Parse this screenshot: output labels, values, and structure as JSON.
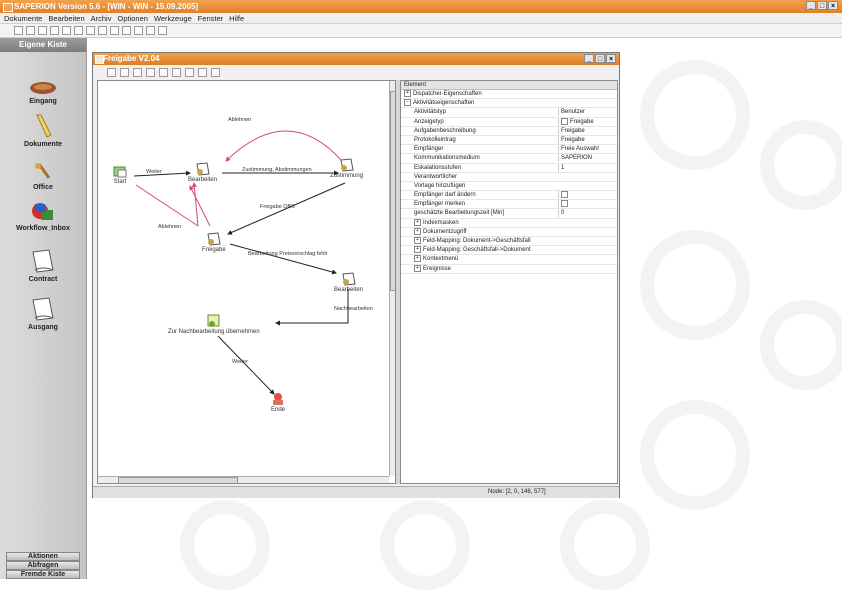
{
  "app": {
    "title": "SAPERION Version 5.6 - [WIN - WIN - 15.09.2005]"
  },
  "menu": [
    "Dokumente",
    "Bearbeiten",
    "Archiv",
    "Optionen",
    "Werkzeuge",
    "Fenster",
    "Hilfe"
  ],
  "sidebar": {
    "title": "Eigene Kiste",
    "items": [
      {
        "label": "Eingang",
        "icon": "inbox-icon"
      },
      {
        "label": "Dokumente",
        "icon": "pen-icon"
      },
      {
        "label": "Office",
        "icon": "office-icon"
      },
      {
        "label": "Workflow_Inbox",
        "icon": "workflow-icon"
      },
      {
        "label": "Contract",
        "icon": "document-icon"
      },
      {
        "label": "Ausgang",
        "icon": "document-icon"
      }
    ],
    "bottom_buttons": [
      "Aktionen",
      "Abfragen",
      "Fremde Kiste"
    ]
  },
  "document": {
    "title": "Freigabe V2.04",
    "status": "Node: [2, 0, 146, 577]"
  },
  "workflow": {
    "nodes": [
      {
        "label": "Start"
      },
      {
        "label": "Bearbeiten"
      },
      {
        "label": "Zustimmung"
      },
      {
        "label": "Freigabe"
      },
      {
        "label": "Bearbeiten"
      },
      {
        "label": "Zur Nachbearbeitung übernehmen"
      },
      {
        "label": "Ende"
      }
    ],
    "edges": [
      {
        "label": "Weiter"
      },
      {
        "label": "Zustimmung, Abstimmungen"
      },
      {
        "label": "Ablehnen"
      },
      {
        "label": "Freigabe OBS"
      },
      {
        "label": "Ablehnen"
      },
      {
        "label": "Bearbeitung Preisvorschlag fehlt"
      },
      {
        "label": "Nachbearbeiten"
      },
      {
        "label": "Weiter"
      }
    ]
  },
  "properties": {
    "header": "Element",
    "rows": [
      {
        "name": "Dispatcher-Eigenschaften",
        "value": "",
        "type": "group-collapsed",
        "indent": 0
      },
      {
        "name": "Aktivitätseigenschaften",
        "value": "",
        "type": "group-expanded",
        "indent": 0
      },
      {
        "name": "Aktivitätstyp",
        "value": "Benutzer",
        "type": "row",
        "indent": 1
      },
      {
        "name": "Anzeigetyp",
        "value": "Freigabe",
        "type": "row-check",
        "indent": 1
      },
      {
        "name": "Aufgabenbeschreibung",
        "value": "Freigabe",
        "type": "row",
        "indent": 1
      },
      {
        "name": "Protokolleintrag",
        "value": "Freigabe",
        "type": "row",
        "indent": 1
      },
      {
        "name": "Empfänger",
        "value": "Freie Auswahl",
        "type": "row",
        "indent": 1
      },
      {
        "name": "Kommunikationsmedium",
        "value": "SAPERION",
        "type": "row",
        "indent": 1
      },
      {
        "name": "Eskalationsstufen",
        "value": "1",
        "type": "row",
        "indent": 1
      },
      {
        "name": "Verantwortlicher",
        "value": "",
        "type": "row",
        "indent": 1
      },
      {
        "name": "Vorlage hinzufügen",
        "value": "",
        "type": "row",
        "indent": 1
      },
      {
        "name": "Empfänger darf ändern",
        "value": "",
        "type": "row-box",
        "indent": 1
      },
      {
        "name": "Empfänger merken",
        "value": "",
        "type": "row-box",
        "indent": 1
      },
      {
        "name": "geschätzte Bearbeitungszeit [Min]",
        "value": "0",
        "type": "row",
        "indent": 1
      },
      {
        "name": "Indexmasken",
        "value": "",
        "type": "group-collapsed",
        "indent": 1
      },
      {
        "name": "Dokumentzugriff",
        "value": "",
        "type": "group-collapsed",
        "indent": 1
      },
      {
        "name": "Feld-Mapping: Dokument->Geschäftsfall",
        "value": "",
        "type": "group-collapsed",
        "indent": 1
      },
      {
        "name": "Feld-Mapping: Geschäftsfall->Dokument",
        "value": "",
        "type": "group-collapsed",
        "indent": 1
      },
      {
        "name": "Kontextmenü",
        "value": "",
        "type": "group-collapsed",
        "indent": 1
      },
      {
        "name": "Ereignisse",
        "value": "",
        "type": "group-collapsed",
        "indent": 1
      }
    ]
  },
  "colors": {
    "title_orange": "#e0802a",
    "edge_red": "#d64a6a",
    "edge_black": "#222222"
  }
}
